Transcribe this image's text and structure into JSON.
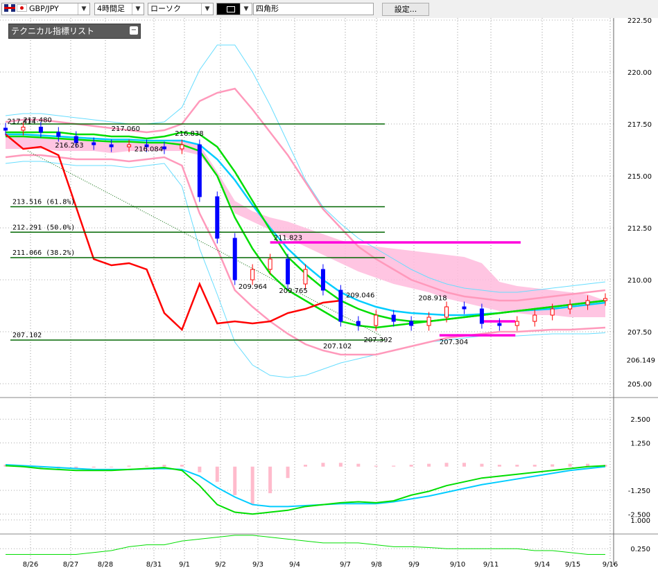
{
  "toolbar": {
    "symbol": "GBP/JPY",
    "timeframe": "4時間足",
    "chart_type": "ローソク",
    "drawing_tool": "四角形",
    "settings_label": "設定..."
  },
  "indicator_panel": {
    "label": "テクニカル指標リスト",
    "collapse_icon": "minus-square-icon"
  },
  "colors": {
    "candle_up": "#ff0000",
    "candle_down": "#0000ff",
    "lagging_span": "#ff0000",
    "ma_green": "#00dd00",
    "ma_cyan": "#00ccff",
    "bollinger_pink": "#ff99bb",
    "bollinger_outer": "#66ddff",
    "cloud": "#ffbbdd",
    "fib_line": "#006600",
    "box": "#ff00dd"
  },
  "chart_data": {
    "type": "candlestick",
    "dates": [
      "8/26",
      "8/27",
      "8/28",
      "8/31",
      "9/1",
      "9/2",
      "9/3",
      "9/4",
      "9/7",
      "9/8",
      "9/9",
      "9/10",
      "9/11",
      "9/14",
      "9/15",
      "9/16"
    ],
    "price_axis": [
      "222.50",
      "220.00",
      "217.50",
      "215.00",
      "212.50",
      "210.00",
      "207.50",
      "205.00"
    ],
    "current_price": "206.149",
    "ylim": [
      204.6,
      222.6
    ],
    "macd_axis": [
      "2.500",
      "1.250",
      "-1.250",
      "-2.500"
    ],
    "macd_ylim": [
      -3.0,
      3.2
    ],
    "rci_axis": [
      "1.000",
      "0.250"
    ],
    "price_labels": [
      {
        "text": "217.480",
        "value": 217.48,
        "idx": 1.0
      },
      {
        "text": "217.414",
        "value": 217.414,
        "idx": 0.1
      },
      {
        "text": "217.060",
        "value": 217.06,
        "idx": 6.0
      },
      {
        "text": "216.838",
        "value": 216.838,
        "idx": 9.6
      },
      {
        "text": "216.263",
        "value": 216.263,
        "idx": 2.8
      },
      {
        "text": "216.084",
        "value": 216.084,
        "idx": 7.3
      },
      {
        "text": "211.823",
        "value": 211.823,
        "idx": 15.2
      },
      {
        "text": "209.964",
        "value": 209.964,
        "idx": 13.2
      },
      {
        "text": "209.765",
        "value": 209.765,
        "idx": 15.5
      },
      {
        "text": "209.046",
        "value": 209.046,
        "idx": 19.3
      },
      {
        "text": "208.918",
        "value": 208.918,
        "idx": 23.4
      },
      {
        "text": "207.392",
        "value": 207.392,
        "idx": 20.3
      },
      {
        "text": "207.304",
        "value": 207.304,
        "idx": 24.6
      },
      {
        "text": "207.102",
        "value": 207.102,
        "idx": 18.0
      }
    ],
    "fib_levels": [
      {
        "label": "213.516 (61.8%)",
        "value": 213.516
      },
      {
        "label": "212.291 (50.0%)",
        "value": 212.291
      },
      {
        "label": "211.066 (38.2%)",
        "value": 211.066
      },
      {
        "label": "207.102",
        "value": 207.102
      }
    ],
    "fib_top": 217.5,
    "boxes": [
      {
        "from": 15.0,
        "to": 29.2,
        "value": 211.8
      },
      {
        "from": 27.1,
        "to": 28.9,
        "value": 208.0
      },
      {
        "from": 24.6,
        "to": 28.9,
        "value": 207.33
      }
    ],
    "close": [
      217.2,
      217.35,
      217.1,
      216.9,
      216.6,
      216.5,
      216.4,
      216.5,
      216.4,
      216.3,
      216.5,
      214.0,
      212.0,
      210.0,
      210.5,
      211.0,
      209.8,
      210.5,
      209.5,
      208.0,
      207.8,
      208.3,
      208.0,
      207.8,
      208.2,
      208.7,
      208.6,
      207.9,
      207.8,
      208.0,
      208.3,
      208.6,
      208.8,
      209.0,
      209.1
    ],
    "ohlc_note": "",
    "lagging_span": [
      217.0,
      216.3,
      216.4,
      216.0,
      213.5,
      211.0,
      210.7,
      210.8,
      210.5,
      208.4,
      207.6,
      209.8,
      207.9,
      208.0,
      207.9,
      208.0,
      208.4,
      208.6,
      208.9,
      209.0
    ],
    "ma_green_1": [
      216.9,
      216.9,
      216.85,
      216.8,
      216.75,
      216.7,
      216.65,
      216.65,
      216.6,
      216.6,
      216.5,
      216.2,
      215.0,
      213.0,
      211.5,
      210.3,
      209.5,
      209.0,
      208.5,
      208.0,
      207.8,
      207.7,
      207.8,
      207.9,
      208.0,
      208.1,
      208.2,
      208.3,
      208.4,
      208.5,
      208.6,
      208.7,
      208.8,
      208.9,
      209.0
    ],
    "ma_green_2": [
      217.1,
      217.1,
      217.1,
      217.1,
      217.0,
      217.0,
      216.9,
      216.9,
      216.8,
      216.9,
      217.1,
      217.0,
      216.4,
      215.2,
      213.8,
      212.4,
      211.1,
      210.3,
      209.6,
      209.0,
      208.6,
      208.3,
      208.1,
      208.0,
      208.0,
      208.1,
      208.2,
      208.3,
      208.4,
      208.5,
      208.6,
      208.7,
      208.8,
      208.9,
      209.0
    ],
    "ma_cyan": [
      217.0,
      217.0,
      216.95,
      216.9,
      216.85,
      216.8,
      216.75,
      216.75,
      216.7,
      216.7,
      216.7,
      216.5,
      215.8,
      214.8,
      213.6,
      212.5,
      211.5,
      210.7,
      210.0,
      209.4,
      209.0,
      208.7,
      208.5,
      208.4,
      208.35,
      208.3,
      208.3,
      208.35,
      208.4,
      208.5,
      208.55,
      208.6,
      208.7,
      208.8,
      208.9
    ],
    "bb_upper": [
      217.6,
      217.7,
      217.7,
      217.6,
      217.5,
      217.4,
      217.3,
      217.2,
      217.1,
      217.2,
      217.5,
      218.6,
      219.0,
      219.2,
      218.2,
      217.1,
      216.0,
      214.7,
      213.4,
      212.5,
      211.6,
      211.0,
      210.5,
      210.0,
      209.7,
      209.4,
      209.2,
      209.1,
      209.0,
      209.0,
      209.1,
      209.2,
      209.3,
      209.4,
      209.5
    ],
    "bb_lower": [
      215.9,
      216.0,
      216.0,
      215.9,
      215.8,
      215.8,
      215.8,
      215.7,
      215.8,
      215.9,
      215.5,
      213.2,
      211.5,
      209.5,
      208.7,
      208.0,
      207.4,
      206.9,
      206.6,
      206.4,
      206.4,
      206.4,
      206.6,
      206.8,
      207.0,
      207.2,
      207.3,
      207.4,
      207.5,
      207.5,
      207.55,
      207.6,
      207.6,
      207.65,
      207.7
    ],
    "bb2_upper": [
      217.9,
      218.0,
      218.0,
      217.9,
      217.8,
      217.7,
      217.6,
      217.5,
      217.5,
      217.6,
      218.3,
      220.1,
      221.3,
      221.3,
      220.0,
      218.4,
      216.6,
      214.8,
      213.5,
      212.7,
      212.0,
      211.5,
      211.0,
      210.5,
      210.1,
      209.8,
      209.6,
      209.5,
      209.4,
      209.4,
      209.5,
      209.6,
      209.7,
      209.8,
      209.9
    ],
    "bb2_lower": [
      215.6,
      215.7,
      215.7,
      215.6,
      215.5,
      215.5,
      215.5,
      215.4,
      215.5,
      215.6,
      214.5,
      211.5,
      209.3,
      207.0,
      205.9,
      205.4,
      205.3,
      205.4,
      205.7,
      206.0,
      206.2,
      206.4,
      206.6,
      206.8,
      207.0,
      207.1,
      207.2,
      207.3,
      207.3,
      207.3,
      207.35,
      207.4,
      207.4,
      207.4,
      207.45
    ],
    "cloud_a": [
      216.9,
      216.9,
      216.8,
      216.8,
      216.8,
      216.7,
      216.7,
      216.7,
      216.6,
      216.6,
      216.7,
      216.5,
      215.2,
      213.8,
      213.3,
      213.0,
      212.8,
      212.5,
      212.2,
      211.9,
      211.7,
      211.6,
      211.5,
      211.4,
      211.3,
      211.2,
      211.1,
      210.8,
      209.9,
      209.7,
      209.6,
      209.5,
      209.4,
      209.3,
      209.0
    ],
    "cloud_b": [
      216.3,
      216.3,
      216.3,
      216.2,
      216.2,
      216.2,
      216.1,
      216.2,
      216.2,
      216.2,
      216.2,
      216.0,
      215.0,
      213.2,
      212.8,
      212.4,
      212.0,
      211.6,
      211.2,
      210.8,
      210.4,
      210.1,
      209.8,
      209.6,
      209.4,
      209.1,
      208.9,
      208.7,
      208.5,
      208.4,
      208.3,
      208.3,
      208.2,
      208.2,
      208.2
    ],
    "macd_hist": [
      0.1,
      0.0,
      -0.1,
      -0.15,
      -0.1,
      -0.05,
      0.0,
      0.05,
      0.05,
      0.1,
      0.1,
      -0.3,
      -0.8,
      -1.5,
      -2.0,
      -1.4,
      -0.6,
      0.1,
      0.2,
      0.2,
      0.15,
      0.05,
      0.05,
      0.1,
      0.15,
      0.2,
      0.2,
      0.15,
      0.1,
      0.1,
      0.1,
      0.12,
      0.15,
      0.15,
      0.1
    ],
    "macd_line": [
      0.05,
      0.0,
      -0.1,
      -0.15,
      -0.2,
      -0.2,
      -0.2,
      -0.15,
      -0.1,
      -0.05,
      -0.2,
      -1.0,
      -2.0,
      -2.4,
      -2.5,
      -2.4,
      -2.3,
      -2.1,
      -2.0,
      -1.9,
      -1.85,
      -1.9,
      -1.8,
      -1.5,
      -1.3,
      -1.0,
      -0.8,
      -0.6,
      -0.5,
      -0.4,
      -0.3,
      -0.2,
      -0.1,
      0.0,
      0.05
    ],
    "macd_signal": [
      0.1,
      0.05,
      0.0,
      -0.05,
      -0.1,
      -0.15,
      -0.15,
      -0.15,
      -0.12,
      -0.1,
      -0.15,
      -0.5,
      -1.1,
      -1.6,
      -2.0,
      -2.1,
      -2.1,
      -2.05,
      -2.0,
      -1.95,
      -1.95,
      -1.95,
      -1.85,
      -1.7,
      -1.55,
      -1.35,
      -1.15,
      -0.95,
      -0.8,
      -0.65,
      -0.5,
      -0.35,
      -0.2,
      -0.1,
      0.0
    ],
    "rci": [
      0.1,
      0.1,
      0.1,
      0.1,
      0.1,
      0.15,
      0.2,
      0.3,
      0.35,
      0.35,
      0.45,
      0.5,
      0.55,
      0.6,
      0.6,
      0.55,
      0.5,
      0.45,
      0.4,
      0.4,
      0.4,
      0.35,
      0.3,
      0.3,
      0.28,
      0.25,
      0.25,
      0.25,
      0.25,
      0.25,
      0.2,
      0.2,
      0.15,
      0.1,
      0.1
    ]
  }
}
